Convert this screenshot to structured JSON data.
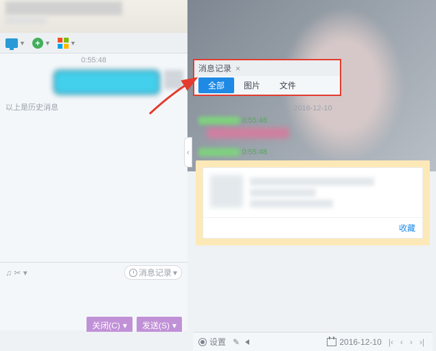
{
  "header": {},
  "toolbar": {
    "icons": [
      "monitor",
      "add",
      "apps"
    ]
  },
  "chat": {
    "timestamp1": "0:55:48",
    "history_note": "以上是历史消息"
  },
  "chat_footer": {
    "tools_left": "♫ ✂ ▾",
    "history_btn": "消息记录",
    "history_btn_arrow": "▾",
    "close_label": "关闭(C)",
    "send_label": "发送(S)",
    "send_arrow": "▾"
  },
  "log_panel": {
    "title": "消息记录",
    "close": "×",
    "tabs": [
      {
        "label": "全部",
        "active": true
      },
      {
        "label": "图片",
        "active": false
      },
      {
        "label": "文件",
        "active": false
      }
    ]
  },
  "history": {
    "date": "2016-12-10",
    "msg1_time": "0:55:48",
    "msg2_time": "0:55:48",
    "card_action": "收藏"
  },
  "footer": {
    "settings_label": "设置",
    "date": "2016-12-10",
    "nav": [
      "|‹",
      "‹",
      "›",
      "›|"
    ]
  },
  "divider": {
    "glyph": "‹"
  }
}
